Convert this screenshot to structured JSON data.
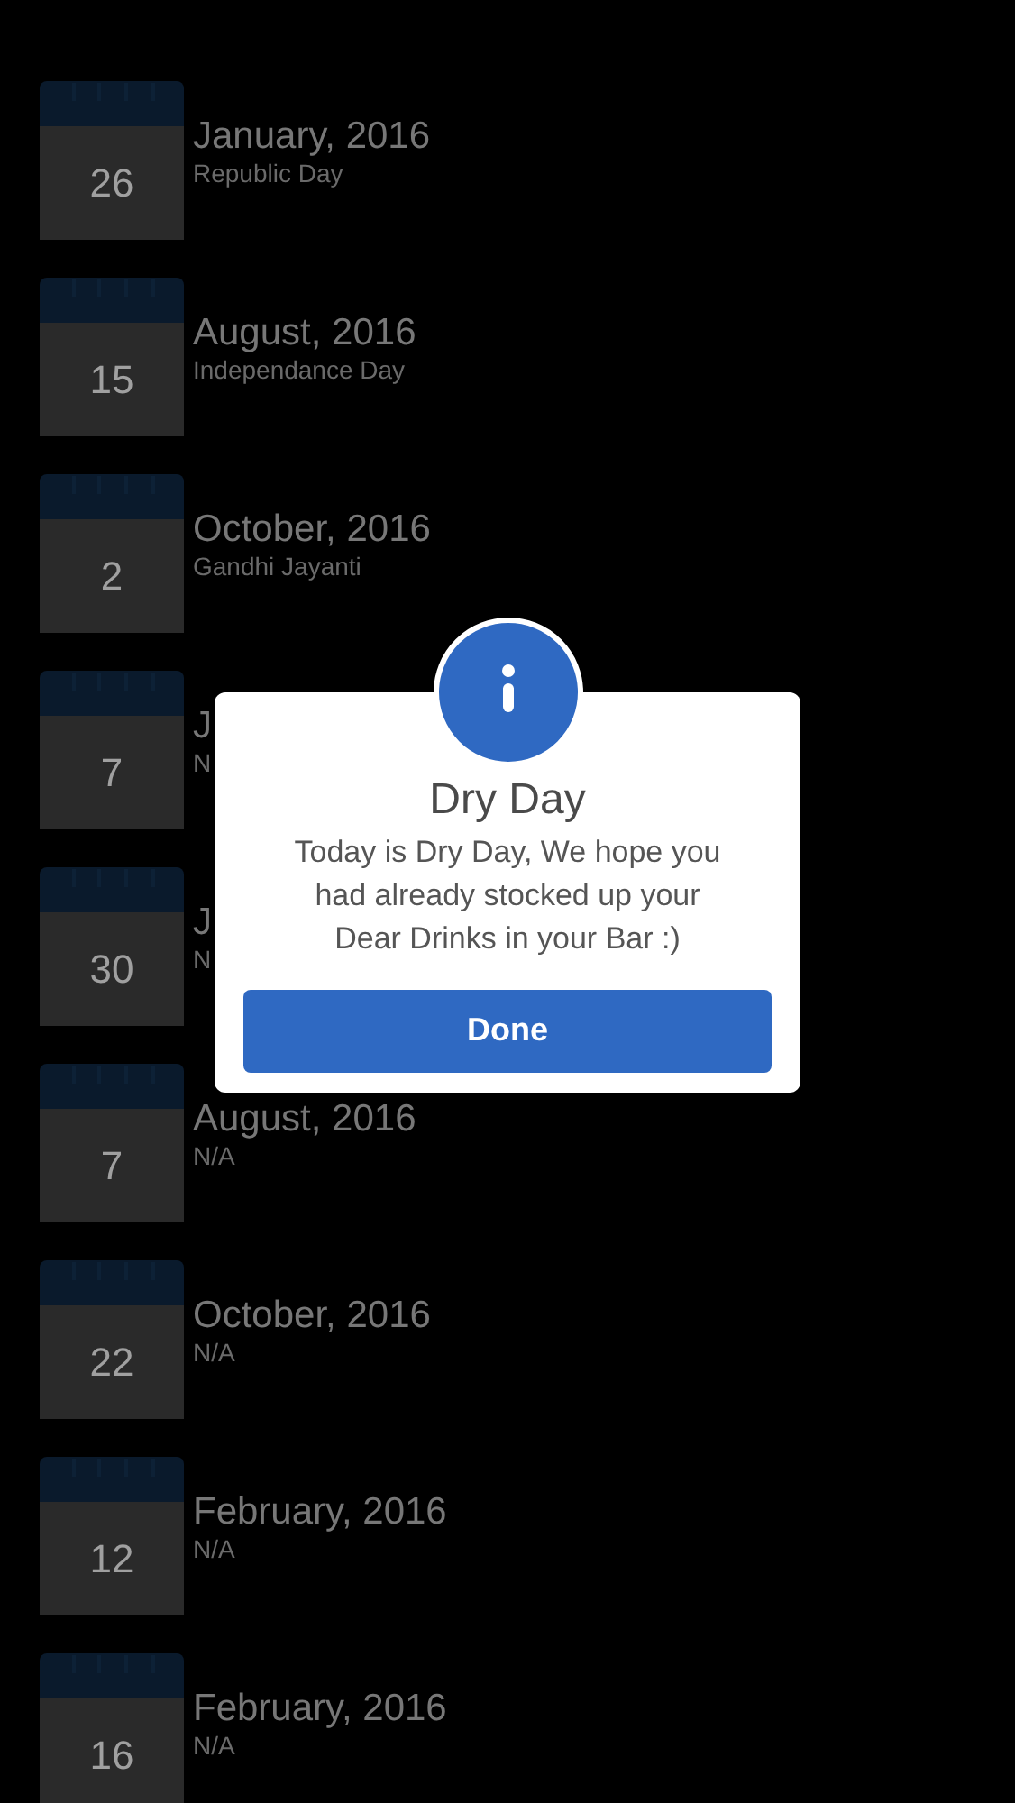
{
  "holidays": [
    {
      "day": "26",
      "title": "January, 2016",
      "subtitle": "Republic Day"
    },
    {
      "day": "15",
      "title": "August, 2016",
      "subtitle": "Independance Day"
    },
    {
      "day": "2",
      "title": "October, 2016",
      "subtitle": "Gandhi Jayanti"
    },
    {
      "day": "7",
      "title": "J",
      "subtitle": "N"
    },
    {
      "day": "30",
      "title": "J",
      "subtitle": "N"
    },
    {
      "day": "7",
      "title": "August, 2016",
      "subtitle": "N/A"
    },
    {
      "day": "22",
      "title": "October, 2016",
      "subtitle": "N/A"
    },
    {
      "day": "12",
      "title": "February, 2016",
      "subtitle": "N/A"
    },
    {
      "day": "16",
      "title": "February, 2016",
      "subtitle": "N/A"
    }
  ],
  "dialog": {
    "title": "Dry Day",
    "message": "Today is Dry Day, We hope you had already stocked up your Dear Drinks in your Bar :)",
    "button": "Done"
  }
}
